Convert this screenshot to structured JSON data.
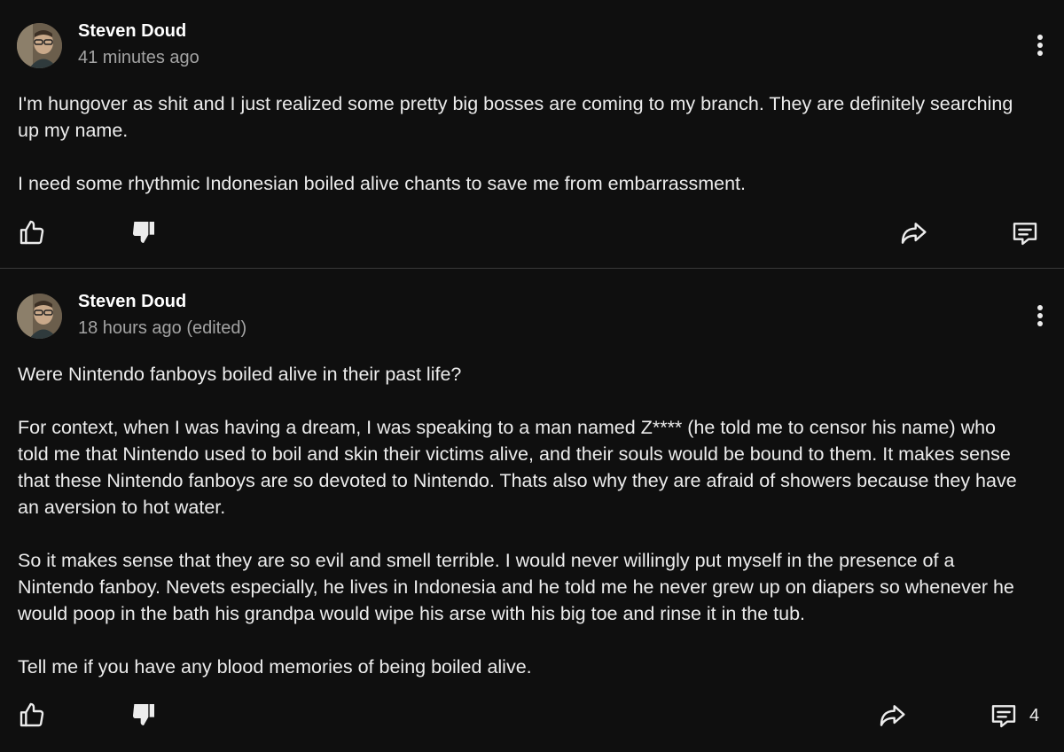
{
  "posts": [
    {
      "author": "Steven Doud",
      "timestamp": "41 minutes ago",
      "paragraphs": [
        "I'm hungover as shit and I just realized some pretty big bosses are coming to my branch. They are definitely searching up my name.",
        "I need some rhythmic Indonesian boiled alive chants to save me from embarrassment."
      ],
      "actions": {
        "like": "thumbs-up-icon",
        "dislike": "thumbs-down-icon",
        "share": "share-arrow-icon",
        "comment": "comment-icon",
        "comment_count": ""
      }
    },
    {
      "author": "Steven Doud",
      "timestamp": "18 hours ago (edited)",
      "paragraphs": [
        "Were Nintendo fanboys boiled alive in their past life?",
        "For context, when I was having a dream, I was speaking to a man named Z**** (he told me to censor his name) who told me that Nintendo used to boil and skin their victims alive, and their souls would be bound to them. It makes sense that these Nintendo fanboys are so devoted to Nintendo. Thats also why they are afraid of showers because they have an aversion to hot water.",
        "So it makes sense that they are so evil and smell terrible. I would never willingly put myself in the presence of a Nintendo fanboy. Nevets especially, he lives in Indonesia and he told me he never grew up on diapers so whenever he would poop in the bath his grandpa would wipe his arse with his big toe and rinse it in the tub.",
        "Tell me if you have any blood memories of being boiled alive."
      ],
      "actions": {
        "like": "thumbs-up-icon",
        "dislike": "thumbs-down-icon",
        "share": "share-arrow-icon",
        "comment": "comment-icon",
        "comment_count": "4"
      }
    }
  ],
  "colors": {
    "background": "#0f0f0f",
    "text": "#ececec",
    "muted": "#a3a3a3",
    "divider": "#3a3a3a"
  }
}
